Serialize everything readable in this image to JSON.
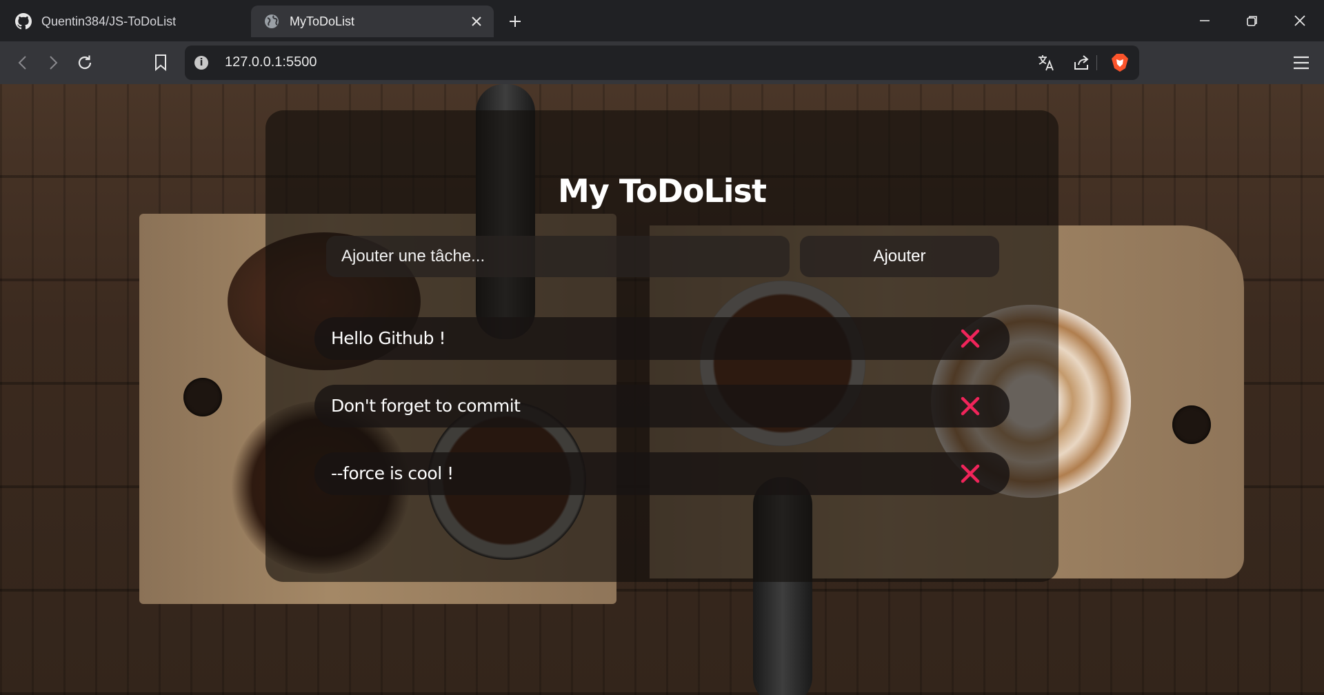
{
  "browser": {
    "tabs": [
      {
        "label": "Quentin384/JS-ToDoList",
        "icon": "github-icon",
        "active": false
      },
      {
        "label": "MyToDoList",
        "icon": "globe-icon",
        "active": true
      }
    ],
    "url": "127.0.0.1:5500"
  },
  "app": {
    "title": "My ToDoList",
    "input_placeholder": "Ajouter une tâche...",
    "add_label": "Ajouter",
    "delete_icon": "close-icon",
    "delete_color": "#f0245a",
    "todos": [
      {
        "text": "Hello Github !"
      },
      {
        "text": "Don't forget to commit"
      },
      {
        "text": "--force is cool !"
      }
    ]
  }
}
